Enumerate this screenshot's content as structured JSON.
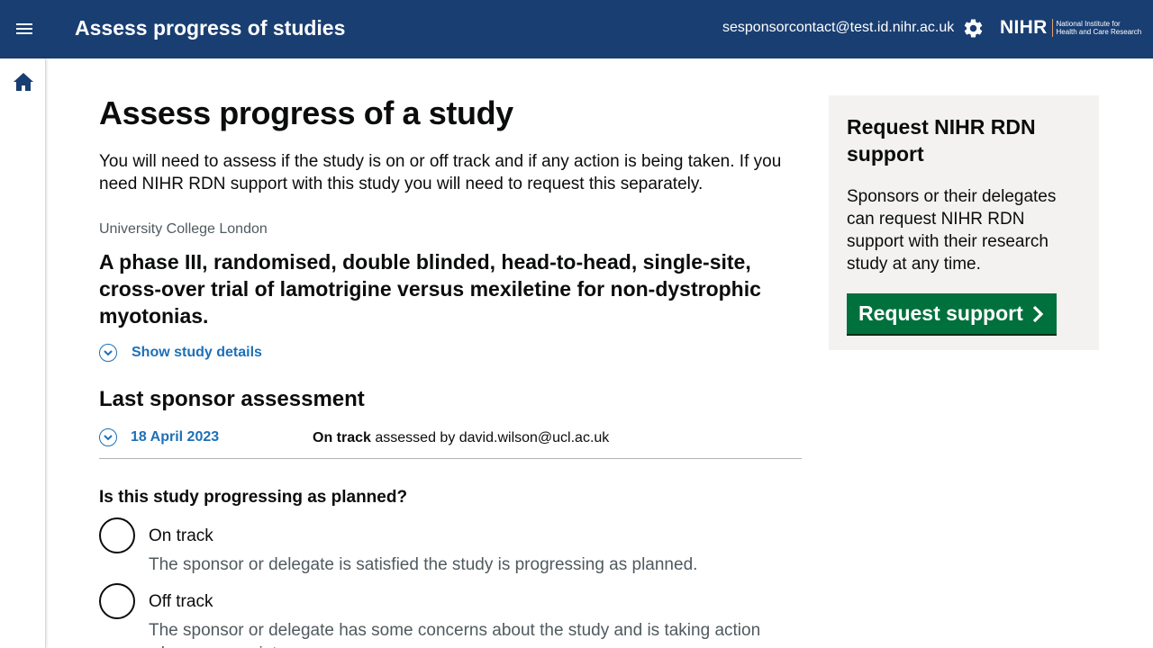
{
  "header": {
    "app_title": "Assess progress of studies",
    "user_email": "sesponsorcontact@test.id.nihr.ac.uk",
    "logo": {
      "wordmark": "NIHR",
      "subtitle_line1": "National Institute for",
      "subtitle_line2": "Health and Care Research"
    },
    "icons": {
      "menu": "menu-icon",
      "settings": "gear-icon"
    }
  },
  "sidebar": {
    "icons": {
      "home": "home-icon"
    }
  },
  "main": {
    "page_title": "Assess progress of a study",
    "intro": "You will need to assess if the study is on or off track and if any action is being taken. If you need NIHR RDN support with this study you will need to request this separately.",
    "organisation": "University College London",
    "study_title": "A phase III, randomised, double blinded, head-to-head, single-site, cross-over trial of lamotrigine versus mexiletine for non-dystrophic myotonias.",
    "show_details_label": "Show study details",
    "last_assessment": {
      "heading": "Last sponsor assessment",
      "date": "18 April 2023",
      "status": "On track",
      "assessed_by_text": "assessed by david.wilson@ucl.ac.uk"
    },
    "question": "Is this study progressing as planned?",
    "options": [
      {
        "label": "On track",
        "hint": "The sponsor or delegate is satisfied the study is progressing as planned."
      },
      {
        "label": "Off track",
        "hint": "The sponsor or delegate has some concerns about the study and is taking action where appropriate."
      }
    ]
  },
  "aside": {
    "title": "Request NIHR RDN support",
    "text": "Sponsors or their delegates can request NIHR RDN support with their research study at any time.",
    "button_label": "Request support"
  },
  "colors": {
    "header_bg": "#193e72",
    "link": "#1d70b8",
    "button_green": "#00703c",
    "aside_bg": "#f3f2f1",
    "hint_text": "#505a5f"
  }
}
